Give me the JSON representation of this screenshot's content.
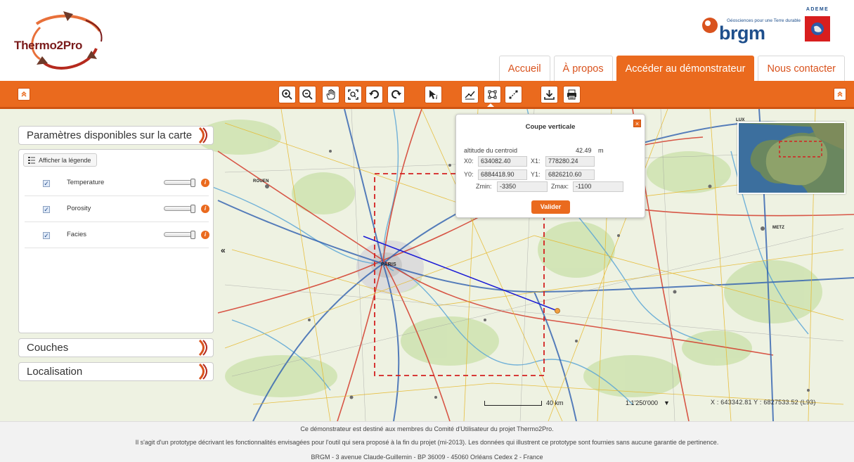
{
  "header": {
    "logo_text": "Thermo2Pro",
    "partner_tagline": "Géosciences pour une Terre durable",
    "partner_name": "brgm",
    "agency_name": "ADEME"
  },
  "tabs": [
    {
      "label": "Accueil",
      "active": false
    },
    {
      "label": "À propos",
      "active": false
    },
    {
      "label": "Accéder au démonstrateur",
      "active": true
    },
    {
      "label": "Nous contacter",
      "active": false
    }
  ],
  "toolbar": {
    "tools": [
      "zoom-in",
      "zoom-out",
      "pan",
      "zoom-extent",
      "undo",
      "redo",
      "info",
      "measure-profile",
      "cross-section",
      "line-measure",
      "download",
      "print"
    ]
  },
  "left_panel": {
    "parameters_title": "Paramètres disponibles sur la carte",
    "legend_button": "Afficher la légende",
    "layers": [
      {
        "label": "Temperature",
        "checked": true,
        "opacity": 1.0
      },
      {
        "label": "Porosity",
        "checked": true,
        "opacity": 1.0
      },
      {
        "label": "Facies",
        "checked": true,
        "opacity": 1.0
      }
    ],
    "couches_title": "Couches",
    "localisation_title": "Localisation"
  },
  "map": {
    "cities": [
      "ROUEN",
      "PARIS",
      "METZ",
      "LUX"
    ]
  },
  "popup": {
    "title": "Coupe verticale",
    "centroid_label": "altitude du centroid",
    "centroid_value": "42.49",
    "centroid_unit": "m",
    "x0_label": "X0:",
    "x0": "634082.40",
    "x1_label": "X1:",
    "x1": "778280.24",
    "y0_label": "Y0:",
    "y0": "6884418.90",
    "y1_label": "Y1:",
    "y1": "6826210.60",
    "zmin_label": "Zmin:",
    "zmin": "-3350",
    "zmax_label": "Zmax:",
    "zmax": "-1100",
    "submit": "Valider"
  },
  "scale": {
    "bar_label": "40 km",
    "ratio": "1:1'250'000"
  },
  "coords": "X : 643342.81 Y : 6827533.52 (L93)",
  "footer": {
    "line1": "Ce démonstrateur est destiné aux membres du Comité d'Utilisateur du projet Thermo2Pro.",
    "line2": "Il s'agit d'un prototype décrivant les fonctionnalités envisagées pour l'outil qui sera proposé à la fin du projet (mi-2013). Les données qui illustrent ce prototype sont fournies sans aucune garantie de pertinence.",
    "line3": "BRGM - 3 avenue Claude-Guillemin - BP 36009 - 45060 Orléans Cedex 2 - France"
  },
  "colors": {
    "accent": "#ea6a1e",
    "brand_blue": "#1e4f8c",
    "profile_line": "#1a1ad6",
    "selection_rect": "#d42020"
  }
}
